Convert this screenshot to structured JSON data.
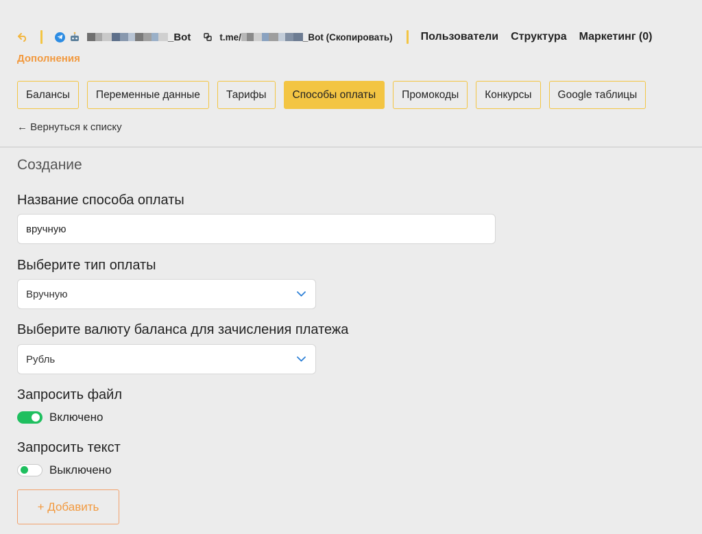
{
  "header": {
    "bot_name": "_Bot",
    "link_prefix": "t.me/",
    "link_suffix": "_Bot (Скопировать)",
    "nav": [
      "Пользователи",
      "Структура",
      "Маркетинг (0)"
    ],
    "section": "Дополнения",
    "icons": {
      "back": "back-arrow-icon",
      "telegram": "telegram-icon",
      "bot": "bot-avatar-icon",
      "link": "link-icon"
    },
    "accent_color": "#f3c543"
  },
  "tabs": [
    {
      "label": "Балансы",
      "active": false
    },
    {
      "label": "Переменные данные",
      "active": false
    },
    {
      "label": "Тарифы",
      "active": false
    },
    {
      "label": "Способы оплаты",
      "active": true
    },
    {
      "label": "Промокоды",
      "active": false
    },
    {
      "label": "Конкурсы",
      "active": false
    },
    {
      "label": "Google таблицы",
      "active": false
    }
  ],
  "back_link": "← Вернуться к списку",
  "form": {
    "title": "Создание",
    "name_label": "Название способа оплаты",
    "name_value": "вручную",
    "type_label": "Выберите тип оплаты",
    "type_value": "Вручную",
    "currency_label": "Выберите валюту баланса для зачисления платежа",
    "currency_value": "Рубль",
    "request_file_label": "Запросить файл",
    "request_file_state": "Включено",
    "request_file_on": true,
    "request_text_label": "Запросить текст",
    "request_text_state": "Выключено",
    "request_text_on": false,
    "add_button": "+ Добавить",
    "toggle_color": "#1fbf5f"
  }
}
